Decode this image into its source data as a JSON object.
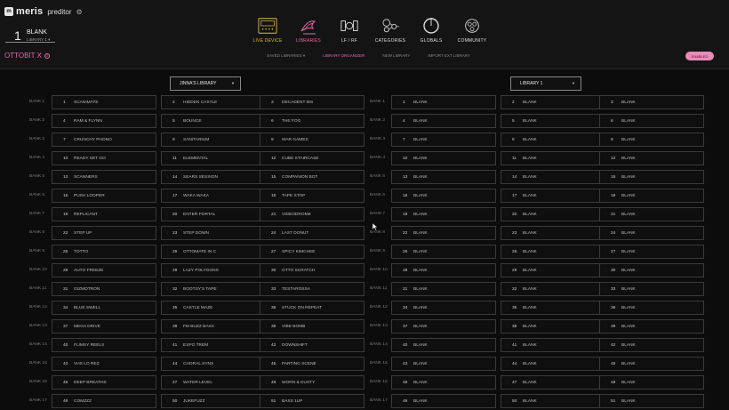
{
  "app": {
    "brand": "meris",
    "product": "preditor",
    "logo_text": "m"
  },
  "current_preset": {
    "number": "1",
    "name": "BLANK",
    "library": "LIBRARY 1 ▾"
  },
  "nav": [
    {
      "key": "live",
      "label": "LIVE DEVICE",
      "icon": "pedal-icon"
    },
    {
      "key": "libraries",
      "label": "LIBRARIES",
      "icon": "library-icon"
    },
    {
      "key": "lfrf",
      "label": "LF / RF",
      "icon": "lf-rf-icon"
    },
    {
      "key": "categories",
      "label": "CATEGORIES",
      "icon": "categories-icon"
    },
    {
      "key": "globals",
      "label": "GLOBALS",
      "icon": "globals-icon"
    },
    {
      "key": "community",
      "label": "COMMUNITY",
      "icon": "community-icon"
    }
  ],
  "device": {
    "name": "OTTOBIT X",
    "info_icon": "⊙"
  },
  "subnav": {
    "saved_libraries": "SAVED LIBRARIES ▾",
    "library_organizer": "LIBRARY ORGANIZER",
    "new_library": "NEW LIBRARY",
    "import_library": "IMPORT EXT LIBRARY"
  },
  "enabled_label": "ENABLED",
  "colors": {
    "accent_pink": "#e56aa7",
    "accent_gold": "#d8b94a"
  },
  "left_library": {
    "name": "JINNA'S LIBRARY",
    "banks": [
      {
        "label": "BANK 1",
        "presets": [
          [
            "1",
            "SCANIMATE"
          ],
          [
            "2",
            "HIDDEN CASTLE"
          ],
          [
            "3",
            "DECADENT 80s"
          ]
        ]
      },
      {
        "label": "BANK 2",
        "presets": [
          [
            "4",
            "RAM & FLYNN"
          ],
          [
            "5",
            "BOUNCE"
          ],
          [
            "6",
            "THE FOG"
          ]
        ]
      },
      {
        "label": "BANK 3",
        "presets": [
          [
            "7",
            "CRUNCHY PHONO"
          ],
          [
            "8",
            "SANITARIUM"
          ],
          [
            "9",
            "WAR GAMES"
          ]
        ]
      },
      {
        "label": "BANK 4",
        "presets": [
          [
            "10",
            "READY SET GO"
          ],
          [
            "11",
            "ELEMENTAL"
          ],
          [
            "12",
            "CUBE STAIRCASE"
          ]
        ]
      },
      {
        "label": "BANK 5",
        "presets": [
          [
            "13",
            "SCANNERS"
          ],
          [
            "14",
            "SEARS SESSION"
          ],
          [
            "15",
            "COMPANION BOT"
          ]
        ]
      },
      {
        "label": "BANK 6",
        "presets": [
          [
            "16",
            "PUSH LOOPER"
          ],
          [
            "17",
            "WAKA WAKA"
          ],
          [
            "18",
            "TAPE STOP"
          ]
        ]
      },
      {
        "label": "BANK 7",
        "presets": [
          [
            "19",
            "REPLICANT"
          ],
          [
            "20",
            "ENTER PORTAL"
          ],
          [
            "21",
            "VIDEODROME"
          ]
        ]
      },
      {
        "label": "BANK 8",
        "presets": [
          [
            "22",
            "STEP UP"
          ],
          [
            "23",
            "STEP DOWN"
          ],
          [
            "24",
            "LAST DONUT"
          ]
        ]
      },
      {
        "label": "BANK 9",
        "presets": [
          [
            "25",
            "TOTTO"
          ],
          [
            "26",
            "OTTOMATE IN C"
          ],
          [
            "27",
            "SPICY KIMCHEE"
          ]
        ]
      },
      {
        "label": "BANK 10",
        "presets": [
          [
            "28",
            "AUTO FREEZE"
          ],
          [
            "29",
            "LAZY POLYGONS"
          ],
          [
            "30",
            "OTTO SCRATCH"
          ]
        ]
      },
      {
        "label": "BANK 11",
        "presets": [
          [
            "31",
            "GIZMOTRON"
          ],
          [
            "32",
            "BOOTSY'S TAPE"
          ],
          [
            "33",
            "TESTAROSSA"
          ]
        ]
      },
      {
        "label": "BANK 12",
        "presets": [
          [
            "34",
            "BLUE SWELL"
          ],
          [
            "35",
            "CASTLE MAZE"
          ],
          [
            "36",
            "STUCK ON REPEAT"
          ]
        ]
      },
      {
        "label": "BANK 13",
        "presets": [
          [
            "37",
            "MEGA DRIVE"
          ],
          [
            "38",
            "FM BUZZ BASS"
          ],
          [
            "39",
            "VIBE BOMB"
          ]
        ]
      },
      {
        "label": "BANK 14",
        "presets": [
          [
            "40",
            "FLIMSY REELS"
          ],
          [
            "41",
            "EXPO TREM"
          ],
          [
            "42",
            "DOWNSHIFT"
          ]
        ]
      },
      {
        "label": "BANK 15",
        "presets": [
          [
            "43",
            "VHS LO REZ"
          ],
          [
            "44",
            "CHORAL SYNS"
          ],
          [
            "45",
            "PARTING SCENE"
          ]
        ]
      },
      {
        "label": "BANK 16",
        "presets": [
          [
            "46",
            "DEEP BREATHS"
          ],
          [
            "47",
            "WATER LEVEL"
          ],
          [
            "48",
            "WORN & DUSTY"
          ]
        ]
      },
      {
        "label": "BANK 17",
        "presets": [
          [
            "49",
            "COMZZZ"
          ],
          [
            "50",
            "JUKEFUZZ"
          ],
          [
            "51",
            "BASS 1UP"
          ]
        ]
      }
    ]
  },
  "right_library": {
    "name": "LIBRARY 1",
    "banks": [
      {
        "label": "BANK 1",
        "presets": [
          [
            "1",
            "BLANK"
          ],
          [
            "2",
            "BLANK"
          ],
          [
            "3",
            "BLANK"
          ]
        ]
      },
      {
        "label": "BANK 2",
        "presets": [
          [
            "4",
            "BLANK"
          ],
          [
            "5",
            "BLANK"
          ],
          [
            "6",
            "BLANK"
          ]
        ]
      },
      {
        "label": "BANK 3",
        "presets": [
          [
            "7",
            "BLANK"
          ],
          [
            "8",
            "BLANK"
          ],
          [
            "9",
            "BLANK"
          ]
        ]
      },
      {
        "label": "BANK 4",
        "presets": [
          [
            "10",
            "BLANK"
          ],
          [
            "11",
            "BLANK"
          ],
          [
            "12",
            "BLANK"
          ]
        ]
      },
      {
        "label": "BANK 5",
        "presets": [
          [
            "13",
            "BLANK"
          ],
          [
            "14",
            "BLANK"
          ],
          [
            "15",
            "BLANK"
          ]
        ]
      },
      {
        "label": "BANK 6",
        "presets": [
          [
            "16",
            "BLANK"
          ],
          [
            "17",
            "BLANK"
          ],
          [
            "18",
            "BLANK"
          ]
        ]
      },
      {
        "label": "BANK 7",
        "presets": [
          [
            "19",
            "BLANK"
          ],
          [
            "20",
            "BLANK"
          ],
          [
            "21",
            "BLANK"
          ]
        ]
      },
      {
        "label": "BANK 8",
        "presets": [
          [
            "22",
            "BLANK"
          ],
          [
            "23",
            "BLANK"
          ],
          [
            "24",
            "BLANK"
          ]
        ]
      },
      {
        "label": "BANK 9",
        "presets": [
          [
            "25",
            "BLANK"
          ],
          [
            "26",
            "BLANK"
          ],
          [
            "27",
            "BLANK"
          ]
        ]
      },
      {
        "label": "BANK 10",
        "presets": [
          [
            "28",
            "BLANK"
          ],
          [
            "29",
            "BLANK"
          ],
          [
            "30",
            "BLANK"
          ]
        ]
      },
      {
        "label": "BANK 11",
        "presets": [
          [
            "31",
            "BLANK"
          ],
          [
            "32",
            "BLANK"
          ],
          [
            "33",
            "BLANK"
          ]
        ]
      },
      {
        "label": "BANK 12",
        "presets": [
          [
            "34",
            "BLANK"
          ],
          [
            "35",
            "BLANK"
          ],
          [
            "36",
            "BLANK"
          ]
        ]
      },
      {
        "label": "BANK 13",
        "presets": [
          [
            "37",
            "BLANK"
          ],
          [
            "38",
            "BLANK"
          ],
          [
            "39",
            "BLANK"
          ]
        ]
      },
      {
        "label": "BANK 14",
        "presets": [
          [
            "40",
            "BLANK"
          ],
          [
            "41",
            "BLANK"
          ],
          [
            "42",
            "BLANK"
          ]
        ]
      },
      {
        "label": "BANK 15",
        "presets": [
          [
            "43",
            "BLANK"
          ],
          [
            "44",
            "BLANK"
          ],
          [
            "45",
            "BLANK"
          ]
        ]
      },
      {
        "label": "BANK 16",
        "presets": [
          [
            "46",
            "BLANK"
          ],
          [
            "47",
            "BLANK"
          ],
          [
            "48",
            "BLANK"
          ]
        ]
      },
      {
        "label": "BANK 17",
        "presets": [
          [
            "49",
            "BLANK"
          ],
          [
            "50",
            "BLANK"
          ],
          [
            "51",
            "BLANK"
          ]
        ]
      }
    ]
  }
}
